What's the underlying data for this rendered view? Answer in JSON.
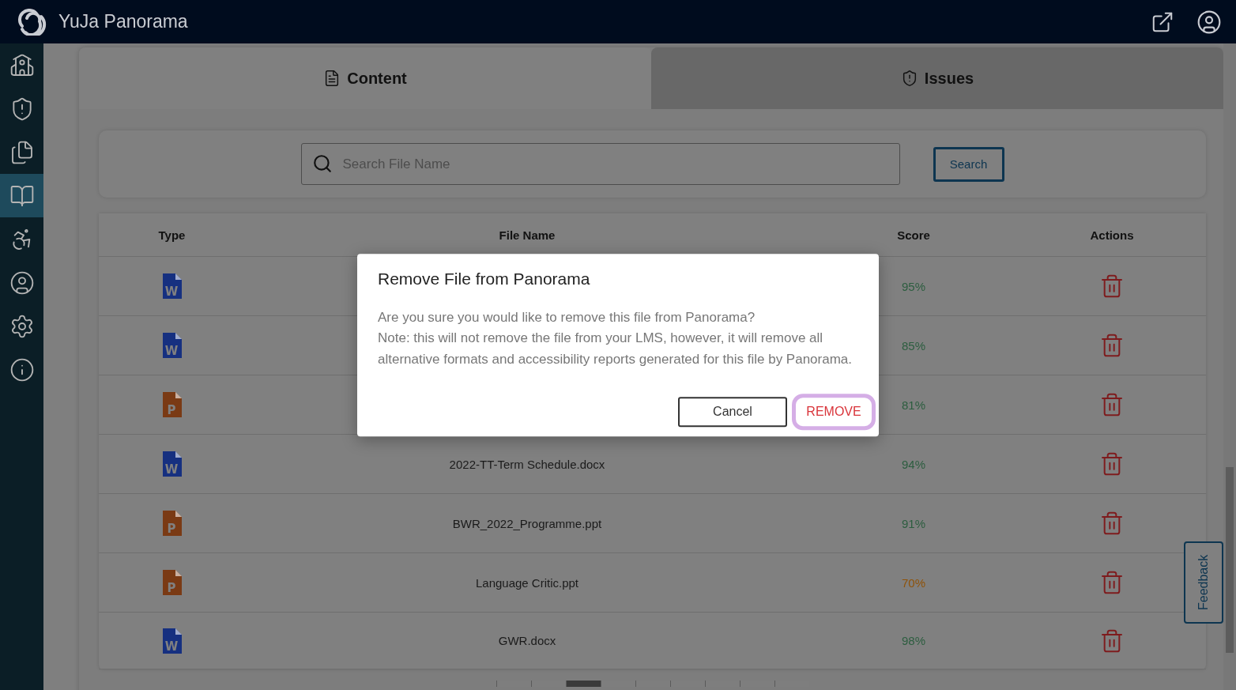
{
  "header": {
    "title": "YuJa Panorama"
  },
  "sidebar": {
    "items": [
      {
        "kind": "building",
        "selected": false
      },
      {
        "kind": "shield",
        "selected": false
      },
      {
        "kind": "documents",
        "selected": false
      },
      {
        "kind": "book",
        "selected": true
      },
      {
        "kind": "accessibility",
        "selected": false
      },
      {
        "kind": "user",
        "selected": false
      },
      {
        "kind": "gear",
        "selected": false
      },
      {
        "kind": "info",
        "selected": false
      }
    ]
  },
  "tabs": [
    {
      "label": "Content",
      "kind": "list",
      "selected": true
    },
    {
      "label": "Issues",
      "kind": "shield",
      "selected": false
    }
  ],
  "search": {
    "placeholder": "Search File Name",
    "button": "Search"
  },
  "table": {
    "columns": [
      "Type",
      "File Name",
      "Score",
      "Actions"
    ],
    "rows": [
      {
        "type": "W",
        "kind": "word",
        "score": "95%",
        "color": "#2c5d3f"
      },
      {
        "type": "W",
        "kind": "word",
        "score": "85%",
        "color": "#2c5d3f"
      },
      {
        "type": "P",
        "kind": "powerpoint",
        "score": "81%",
        "color": "#2c5d3f"
      },
      {
        "type": "W",
        "kind": "word",
        "name": "2022-TT-Term Schedule.docx",
        "score": "94%",
        "color": "#2c5d3f"
      },
      {
        "type": "P",
        "kind": "powerpoint",
        "name": "BWR_2022_Programme.ppt",
        "score": "91%",
        "color": "#2c5d3f"
      },
      {
        "type": "P",
        "kind": "powerpoint",
        "name": "Language Critic.ppt",
        "score": "70%",
        "color": "#8f5208"
      },
      {
        "type": "W",
        "kind": "word",
        "name": "GWR.docx",
        "score": "98%",
        "color": "#2c5d3f"
      }
    ]
  },
  "pagination": [
    {
      "selected": false
    },
    {
      "selected": false
    },
    {
      "selected": true
    },
    {
      "selected": false
    },
    {
      "selected": false
    },
    {
      "selected": false
    },
    {
      "selected": false
    },
    {
      "selected": false
    },
    {
      "selected": false
    }
  ],
  "feedback": "Feedback",
  "dialog": {
    "title": "Remove File from Panorama",
    "lines": [
      "Are you sure you would like to remove this file from Panorama?",
      "Note: this will not remove the file from your LMS, however, it will remove all alternative formats and accessibility reports generated for this file by Panorama."
    ],
    "cancel": "Cancel",
    "confirm": "REMOVE",
    "confirm_focused": true
  }
}
